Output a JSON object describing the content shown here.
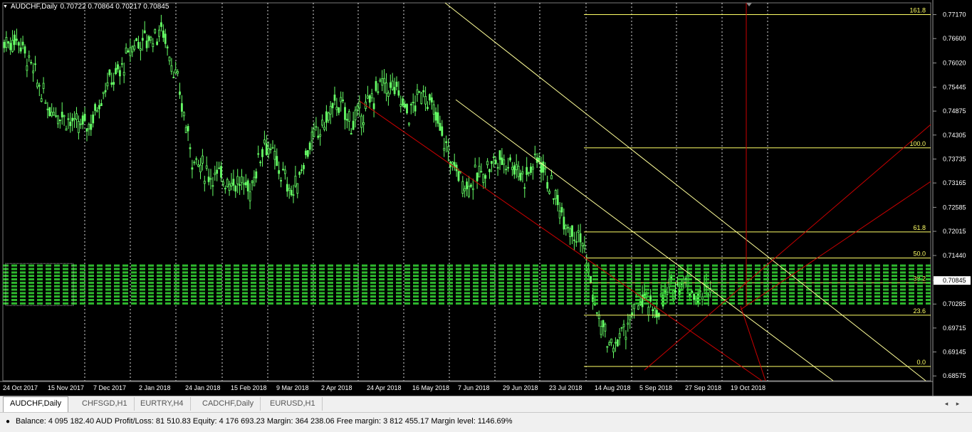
{
  "chart_header": {
    "symbol_tf": "AUDCHF,Daily",
    "ohlc": "0.70722 0.70864 0.70217 0.70845"
  },
  "price_axis": [
    "0.77170",
    "0.76600",
    "0.76020",
    "0.75445",
    "0.74875",
    "0.74305",
    "0.73735",
    "0.73165",
    "0.72585",
    "0.72015",
    "0.71440",
    "0.70845",
    "0.70285",
    "0.69715",
    "0.69145",
    "0.68575"
  ],
  "current_price": "0.70845",
  "date_axis": [
    "24 Oct 2017",
    "15 Nov 2017",
    "7 Dec 2017",
    "2 Jan 2018",
    "24 Jan 2018",
    "15 Feb 2018",
    "9 Mar 2018",
    "2 Apr 2018",
    "24 Apr 2018",
    "16 May 2018",
    "7 Jun 2018",
    "29 Jun 2018",
    "23 Jul 2018",
    "14 Aug 2018",
    "5 Sep 2018",
    "27 Sep 2018",
    "19 Oct 2018"
  ],
  "fib_levels": [
    {
      "label": "161.8",
      "price": 0.7717
    },
    {
      "label": "100.0",
      "price": 0.74
    },
    {
      "label": "61.8",
      "price": 0.72
    },
    {
      "label": "50.0",
      "price": 0.7138
    },
    {
      "label": "38.2",
      "price": 0.7079
    },
    {
      "label": "23.6",
      "price": 0.7002
    },
    {
      "label": "0.0",
      "price": 0.688
    }
  ],
  "colors": {
    "background": "#000000",
    "candle": "#66ff66",
    "grid": "#ffffff",
    "fib": "#ffff66",
    "channel": "#cc0000",
    "trendline": "#ffff99",
    "order_lines": "#33cc33"
  },
  "tabs": [
    {
      "label": "AUDCHF,Daily",
      "active": true
    },
    {
      "label": "CHFSGD,H1",
      "active": false
    },
    {
      "label": "EURTRY,H4",
      "active": false
    },
    {
      "label": "CADCHF,Daily",
      "active": false
    },
    {
      "label": "EURUSD,H1",
      "active": false
    }
  ],
  "tab_scroll": {
    "left": "◂",
    "right": "▸"
  },
  "status": {
    "icon": "coin-icon",
    "text": "Balance: 4 095 182.40 AUD  Profit/Loss: 81 510.83  Equity: 4 176 693.23  Margin: 364 238.06  Free margin: 3 812 455.17  Margin level: 1146.69%"
  },
  "chart_data": {
    "type": "candlestick",
    "symbol": "AUDCHF",
    "timeframe": "Daily",
    "ylim": [
      0.6846,
      0.7745
    ],
    "x_labels": [
      "24 Oct 2017",
      "15 Nov 2017",
      "7 Dec 2017",
      "2 Jan 2018",
      "24 Jan 2018",
      "15 Feb 2018",
      "9 Mar 2018",
      "2 Apr 2018",
      "24 Apr 2018",
      "16 May 2018",
      "7 Jun 2018",
      "29 Jun 2018",
      "23 Jul 2018",
      "14 Aug 2018",
      "5 Sep 2018",
      "27 Sep 2018",
      "19 Oct 2018"
    ],
    "close_path": [
      [
        "24 Oct 2017",
        0.765
      ],
      [
        "1 Nov 2017",
        0.766
      ],
      [
        "8 Nov 2017",
        0.758
      ],
      [
        "15 Nov 2017",
        0.75
      ],
      [
        "22 Nov 2017",
        0.748
      ],
      [
        "29 Nov 2017",
        0.745
      ],
      [
        "7 Dec 2017",
        0.746
      ],
      [
        "14 Dec 2017",
        0.755
      ],
      [
        "21 Dec 2017",
        0.758
      ],
      [
        "2 Jan 2018",
        0.765
      ],
      [
        "9 Jan 2018",
        0.766
      ],
      [
        "16 Jan 2018",
        0.768
      ],
      [
        "24 Jan 2018",
        0.755
      ],
      [
        "1 Feb 2018",
        0.738
      ],
      [
        "8 Feb 2018",
        0.734
      ],
      [
        "15 Feb 2018",
        0.733
      ],
      [
        "22 Feb 2018",
        0.732
      ],
      [
        "1 Mar 2018",
        0.73
      ],
      [
        "9 Mar 2018",
        0.742
      ],
      [
        "16 Mar 2018",
        0.735
      ],
      [
        "23 Mar 2018",
        0.729
      ],
      [
        "2 Apr 2018",
        0.74
      ],
      [
        "9 Apr 2018",
        0.745
      ],
      [
        "16 Apr 2018",
        0.751
      ],
      [
        "24 Apr 2018",
        0.746
      ],
      [
        "1 May 2018",
        0.749
      ],
      [
        "8 May 2018",
        0.755
      ],
      [
        "16 May 2018",
        0.754
      ],
      [
        "23 May 2018",
        0.748
      ],
      [
        "31 May 2018",
        0.754
      ],
      [
        "7 Jun 2018",
        0.746
      ],
      [
        "14 Jun 2018",
        0.736
      ],
      [
        "21 Jun 2018",
        0.731
      ],
      [
        "29 Jun 2018",
        0.734
      ],
      [
        "6 Jul 2018",
        0.737
      ],
      [
        "13 Jul 2018",
        0.737
      ],
      [
        "23 Jul 2018",
        0.733
      ],
      [
        "30 Jul 2018",
        0.738
      ],
      [
        "7 Aug 2018",
        0.729
      ],
      [
        "14 Aug 2018",
        0.722
      ],
      [
        "21 Aug 2018",
        0.718
      ],
      [
        "28 Aug 2018",
        0.7
      ],
      [
        "5 Sep 2018",
        0.692
      ],
      [
        "12 Sep 2018",
        0.697
      ],
      [
        "19 Sep 2018",
        0.704
      ],
      [
        "27 Sep 2018",
        0.701
      ],
      [
        "4 Oct 2018",
        0.706
      ],
      [
        "11 Oct 2018",
        0.709
      ],
      [
        "19 Oct 2018",
        0.704
      ],
      [
        "25 Oct 2018",
        0.708
      ]
    ]
  }
}
